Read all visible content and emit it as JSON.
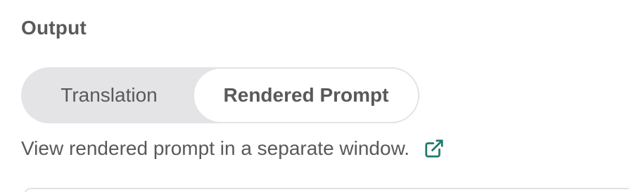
{
  "section": {
    "title": "Output"
  },
  "toggle": {
    "options": [
      {
        "label": "Translation",
        "selected": false
      },
      {
        "label": "Rendered Prompt",
        "selected": true
      }
    ]
  },
  "info": {
    "text": "View rendered prompt in a separate window.",
    "link_icon": "external-link-icon"
  },
  "colors": {
    "text": "#58595b",
    "toggle_track": "#e4e4e6",
    "toggle_selected": "#ffffff",
    "link_icon": "#1f7a6c"
  }
}
